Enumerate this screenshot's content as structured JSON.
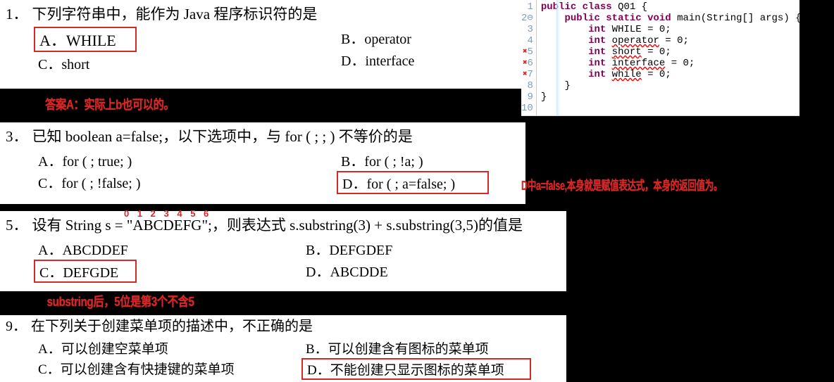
{
  "questions": [
    {
      "num": "1．",
      "text": "下列字符串中，能作为 Java 程序标识符的是",
      "options": {
        "a": "A．WHILE",
        "b": "B．operator",
        "c": "C．short",
        "d": "D．interface"
      },
      "correct": "A",
      "note": "答案A：实际上b也可以的。"
    },
    {
      "num": "3．",
      "text": "已知 boolean a=false;，以下选项中，与 for ( ; ; )  不等价的是",
      "options": {
        "a": "A．for ( ; true; )",
        "b": "B．for ( ; !a; )",
        "c": "C．for ( ; !false; )",
        "d": "D．for ( ; a=false; )"
      },
      "correct": "D",
      "note": "D中a=false,本身就是赋值表达式，本身的返回值为。"
    },
    {
      "num": "5．",
      "text": "设有 String s = \"ABCDEFG\";，则表达式 s.substring(3) + s.substring(3,5)的值是",
      "overlay": "0 1 2 3 4 5 6",
      "options": {
        "a": "A．ABCDDEF",
        "b": "B．DEFGDEF",
        "c": "C．DEFGDE",
        "d": "D．ABCDDE"
      },
      "correct": "C",
      "note": "substring后，5位是第3个不含5"
    },
    {
      "num": "9．",
      "text": "在下列关于创建菜单项的描述中，不正确的是",
      "options": {
        "a": "A．可以创建空菜单项",
        "b": "B．可以创建含有图标的菜单项",
        "c": "C．可以创建含有快捷键的菜单项",
        "d": "D．不能创建只显示图标的菜单项"
      },
      "correct": "D"
    }
  ],
  "code": {
    "lines": [
      {
        "n": "1",
        "err": false,
        "segs": [
          [
            "kw",
            "public "
          ],
          [
            "kw",
            "class "
          ],
          [
            "cls",
            "Q01 {"
          ]
        ]
      },
      {
        "n": "2⊖",
        "err": false,
        "segs": [
          [
            "",
            "    "
          ],
          [
            "kw",
            "public "
          ],
          [
            "kw",
            "static "
          ],
          [
            "kw",
            "void "
          ],
          [
            "cls",
            "main(String[] args) {"
          ]
        ]
      },
      {
        "n": "3",
        "err": false,
        "segs": [
          [
            "",
            "        "
          ],
          [
            "kw",
            "int "
          ],
          [
            "cls",
            "WHILE = "
          ],
          [
            "num",
            "0"
          ],
          [
            "cls",
            ";"
          ]
        ]
      },
      {
        "n": "4",
        "err": false,
        "segs": [
          [
            "",
            "        "
          ],
          [
            "kw",
            "int "
          ],
          [
            "err",
            "operator"
          ],
          [
            "cls",
            " = "
          ],
          [
            "num",
            "0"
          ],
          [
            "cls",
            ";"
          ]
        ]
      },
      {
        "n": "5",
        "err": true,
        "segs": [
          [
            "",
            "        "
          ],
          [
            "kw",
            "int "
          ],
          [
            "err",
            "short"
          ],
          [
            "cls",
            " = "
          ],
          [
            "num",
            "0"
          ],
          [
            "cls",
            ";"
          ]
        ]
      },
      {
        "n": "6",
        "err": true,
        "segs": [
          [
            "",
            "        "
          ],
          [
            "kw",
            "int "
          ],
          [
            "err",
            "interface"
          ],
          [
            "cls",
            " = "
          ],
          [
            "num",
            "0"
          ],
          [
            "cls",
            ";"
          ]
        ]
      },
      {
        "n": "7",
        "err": true,
        "segs": [
          [
            "",
            "        "
          ],
          [
            "kw",
            "int "
          ],
          [
            "err",
            "while"
          ],
          [
            "cls",
            " = "
          ],
          [
            "num",
            "0"
          ],
          [
            "cls",
            ";"
          ]
        ]
      },
      {
        "n": "8",
        "err": false,
        "segs": [
          [
            "cls",
            "    }"
          ]
        ]
      },
      {
        "n": "9",
        "err": false,
        "segs": [
          [
            "cls",
            "}"
          ]
        ]
      },
      {
        "n": "10",
        "err": false,
        "segs": [
          [
            "",
            ""
          ]
        ]
      }
    ]
  }
}
